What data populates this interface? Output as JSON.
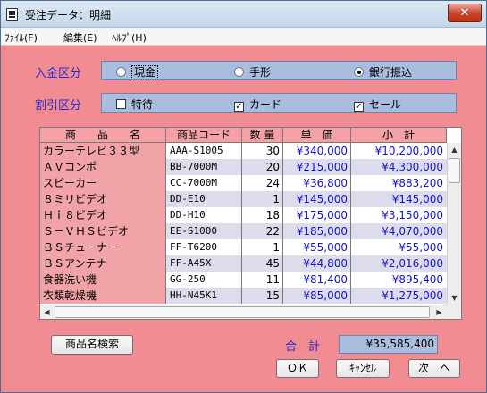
{
  "window": {
    "title": "受注データ：明細",
    "close_glyph": "✕"
  },
  "menu": {
    "items": [
      "ﾌｧｲﾙ(F)",
      "編集(E)",
      "ﾍﾙﾌﾟ(H)"
    ]
  },
  "payment": {
    "label": "入金区分",
    "options": [
      "現金",
      "手形",
      "銀行振込"
    ],
    "selected": "銀行振込"
  },
  "discount": {
    "label": "割引区分",
    "options": [
      "特待",
      "カード",
      "セール"
    ],
    "checked": [
      "カード",
      "セール"
    ]
  },
  "table": {
    "headers": [
      "商　　品　　名",
      "商品コード",
      "数 量",
      "単　価",
      "小　計"
    ],
    "rows": [
      {
        "name": "カラーテレビ３３型",
        "code": "AAA-S1005",
        "qty": "30",
        "price": "¥340,000",
        "subtotal": "¥10,200,000"
      },
      {
        "name": "ＡＶコンポ",
        "code": "BB-7000M",
        "qty": "20",
        "price": "¥215,000",
        "subtotal": "¥4,300,000"
      },
      {
        "name": "スピーカー",
        "code": "CC-7000M",
        "qty": "24",
        "price": "¥36,800",
        "subtotal": "¥883,200"
      },
      {
        "name": "８ミリビデオ",
        "code": "DD-E10",
        "qty": "1",
        "price": "¥145,000",
        "subtotal": "¥145,000"
      },
      {
        "name": "Ｈｉ８ビデオ",
        "code": "DD-H10",
        "qty": "18",
        "price": "¥175,000",
        "subtotal": "¥3,150,000"
      },
      {
        "name": "Ｓ－ＶＨＳビデオ",
        "code": "EE-S1000",
        "qty": "22",
        "price": "¥185,000",
        "subtotal": "¥4,070,000"
      },
      {
        "name": "ＢＳチューナー",
        "code": "FF-T6200",
        "qty": "1",
        "price": "¥55,000",
        "subtotal": "¥55,000"
      },
      {
        "name": "ＢＳアンテナ",
        "code": "FF-A45X",
        "qty": "45",
        "price": "¥44,800",
        "subtotal": "¥2,016,000"
      },
      {
        "name": "食器洗い機",
        "code": "GG-250",
        "qty": "11",
        "price": "¥81,400",
        "subtotal": "¥895,400"
      },
      {
        "name": "衣類乾燥機",
        "code": "HH-N45K1",
        "qty": "15",
        "price": "¥85,000",
        "subtotal": "¥1,275,000"
      }
    ]
  },
  "buttons": {
    "search": "商品名検索",
    "ok": "ＯＫ",
    "cancel": "ｷｬﾝｾﾙ",
    "next": "次　へ"
  },
  "total": {
    "label": "合　計",
    "value": "¥35,585,400"
  },
  "scroll_icons": {
    "up": "▲",
    "down": "▼",
    "left": "◀",
    "right": "▶"
  }
}
